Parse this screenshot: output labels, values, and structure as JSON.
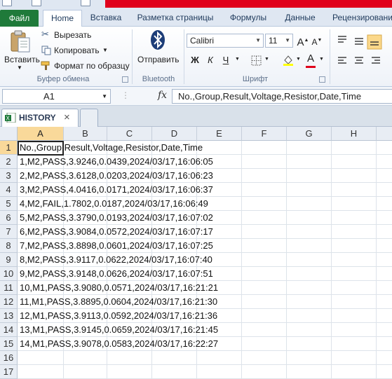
{
  "ribbon_tabs": [
    "Файл",
    "Home",
    "Вставка",
    "Разметка страницы",
    "Формулы",
    "Данные",
    "Рецензирование"
  ],
  "clipboard": {
    "paste_label": "Вставить",
    "cut_label": "Вырезать",
    "copy_label": "Копировать",
    "format_painter_label": "Формат по образцу",
    "group_label": "Буфер обмена"
  },
  "bluetooth": {
    "send_label": "Отправить",
    "group_label": "Bluetooth"
  },
  "font": {
    "name": "Calibri",
    "size": "11",
    "bold": "Ж",
    "italic": "К",
    "underline": "Ч",
    "grow": "A",
    "shrink": "A",
    "font_color_letter": "A",
    "group_label": "Шрифт"
  },
  "formula_bar": {
    "name_box": "A1",
    "fx": "fx",
    "content": "No.,Group,Result,Voltage,Resistor,Date,Time"
  },
  "workbook_tab": {
    "name": "HISTORY",
    "close": "×"
  },
  "columns": [
    "A",
    "B",
    "C",
    "D",
    "E",
    "F",
    "G",
    "H"
  ],
  "rows": [
    "1",
    "2",
    "3",
    "4",
    "5",
    "6",
    "7",
    "8",
    "9",
    "10",
    "11",
    "12",
    "13",
    "14",
    "15",
    "16",
    "17"
  ],
  "cells": [
    "No.,Group,Result,Voltage,Resistor,Date,Time",
    "1,M2,PASS,3.9246,0.0439,2024/03/17,16:06:05",
    "2,M2,PASS,3.6128,0.0203,2024/03/17,16:06:23",
    "3,M2,PASS,4.0416,0.0171,2024/03/17,16:06:37",
    "4,M2,FAIL,1.7802,0.0187,2024/03/17,16:06:49",
    "5,M2,PASS,3.3790,0.0193,2024/03/17,16:07:02",
    "6,M2,PASS,3.9084,0.0572,2024/03/17,16:07:17",
    "7,M2,PASS,3.8898,0.0601,2024/03/17,16:07:25",
    "8,M2,PASS,3.9117,0.0622,2024/03/17,16:07:40",
    "9,M2,PASS,3.9148,0.0626,2024/03/17,16:07:51",
    "10,M1,PASS,3.9080,0.0571,2024/03/17,16:21:21",
    "11,M1,PASS,3.8895,0.0604,2024/03/17,16:21:30",
    "12,M1,PASS,3.9113,0.0592,2024/03/17,16:21:36",
    "13,M1,PASS,3.9145,0.0659,2024/03/17,16:21:45",
    "14,M1,PASS,3.9078,0.0583,2024/03/17,16:22:27",
    "",
    ""
  ],
  "colors": {
    "file_tab": "#1f7a3a",
    "title_accent": "#e0001b",
    "selected_header": "#f9d99a"
  }
}
